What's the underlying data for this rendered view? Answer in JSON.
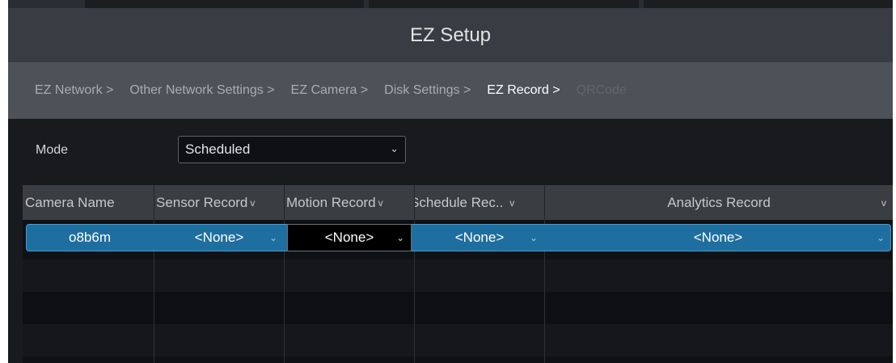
{
  "window": {
    "title": "EZ Setup"
  },
  "breadcrumb": [
    {
      "label": "EZ Network >",
      "state": "normal"
    },
    {
      "label": "Other Network Settings >",
      "state": "normal"
    },
    {
      "label": "EZ Camera >",
      "state": "normal"
    },
    {
      "label": "Disk Settings >",
      "state": "normal"
    },
    {
      "label": "EZ Record >",
      "state": "active"
    },
    {
      "label": "QRCode",
      "state": "disabled"
    }
  ],
  "mode": {
    "label": "Mode",
    "value": "Scheduled",
    "icon": "chevron-down-icon"
  },
  "table": {
    "columns": [
      {
        "label": "Camera Name",
        "dropdown": false
      },
      {
        "label": "Sensor Record",
        "dropdown": true
      },
      {
        "label": "Motion Record",
        "dropdown": true
      },
      {
        "label": "Schedule Rec..",
        "dropdown": true
      },
      {
        "label": "Analytics Record",
        "dropdown": true
      }
    ],
    "rows": [
      {
        "camera": "o8b6m",
        "sensor": "<None>",
        "motion": "<None>",
        "schedule": "<None>",
        "analytics": "<None>",
        "selected": true
      }
    ],
    "dropdown_glyph": "v"
  },
  "colors": {
    "title_bar": "#393c43",
    "breadcrumb_bg": "#4d5258",
    "selected_row": "#1f6ea0",
    "selected_border": "#3f9fd6",
    "content_bg": "#181a1e"
  }
}
